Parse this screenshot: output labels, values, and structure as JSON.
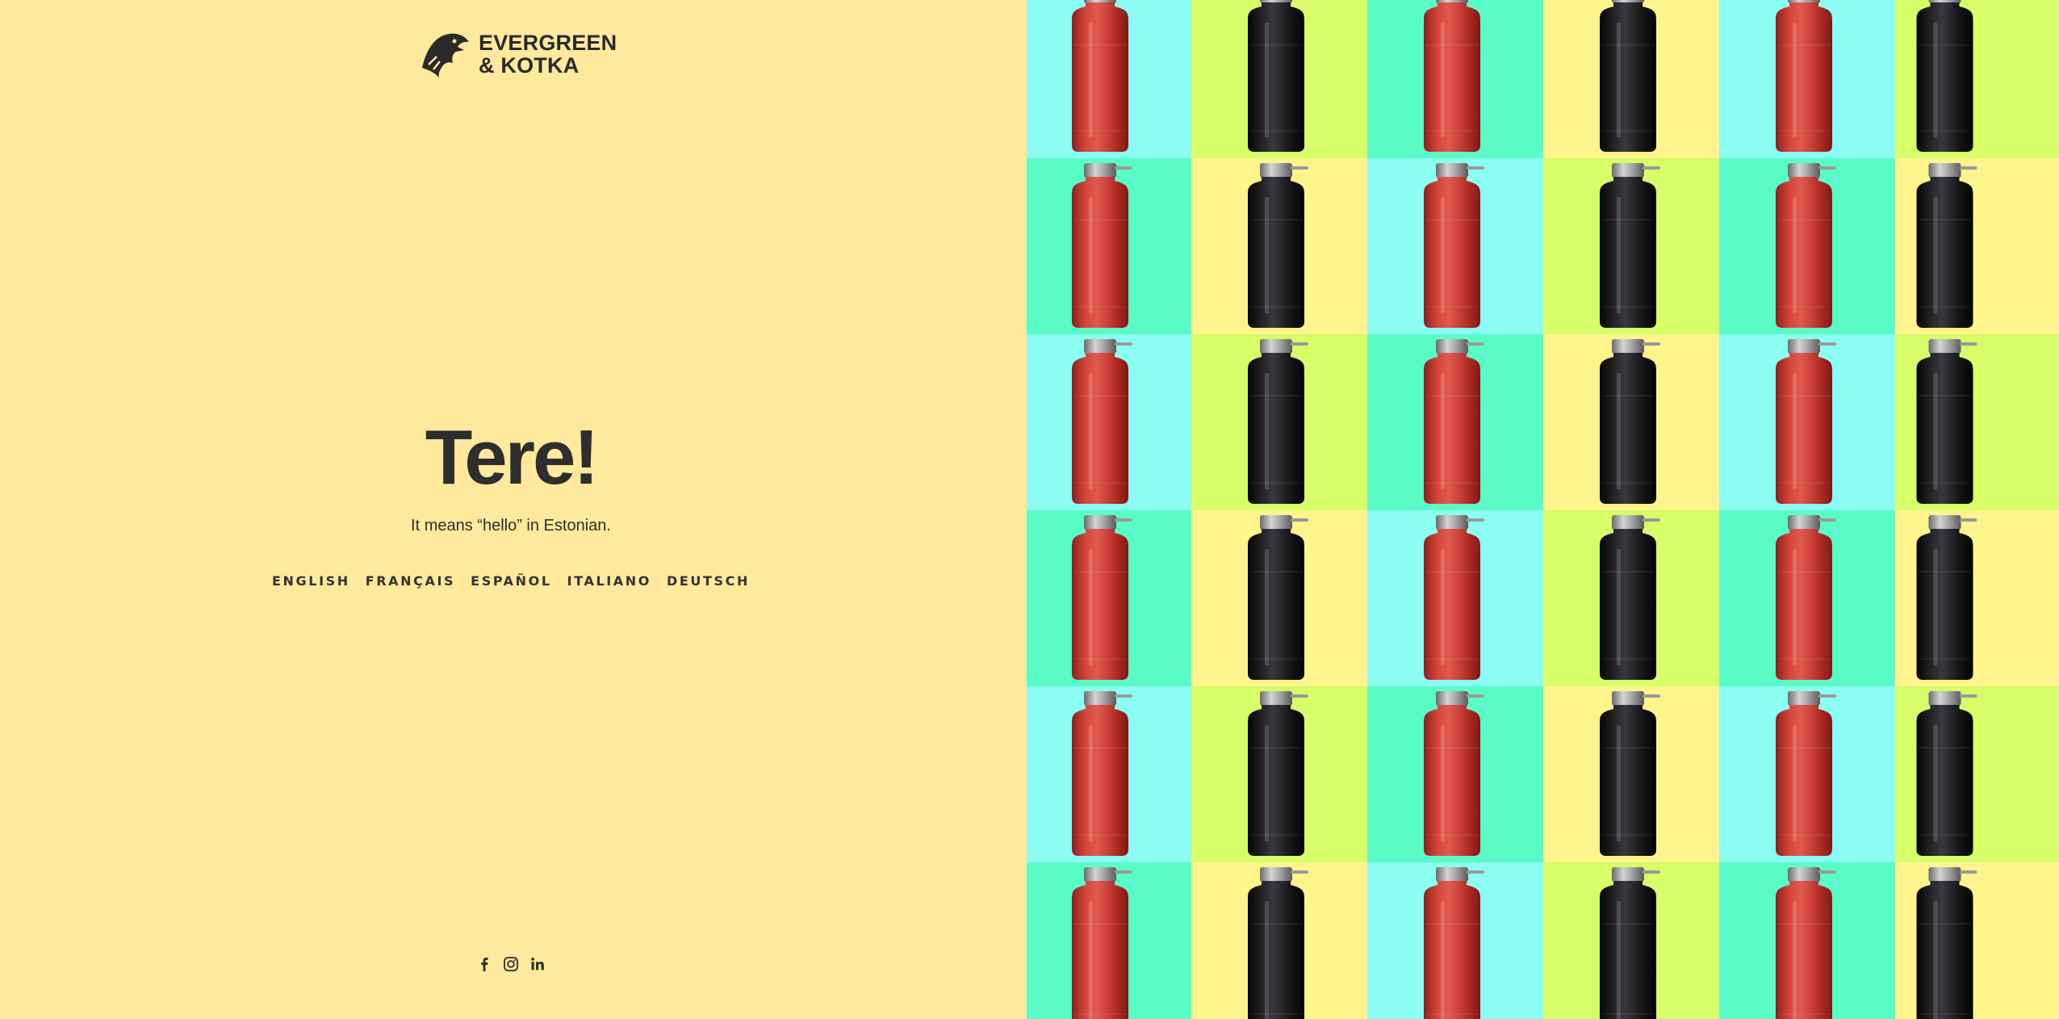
{
  "brand": {
    "line1": "EVERGREEN",
    "line2": "& KOTKA"
  },
  "hero": {
    "headline": "Tere!",
    "subline": "It means “hello” in Estonian."
  },
  "languages": [
    "ENGLISH",
    "FRANÇAIS",
    "ESPAÑOL",
    "ITALIANO",
    "DEUTSCH"
  ],
  "social": [
    "facebook-icon",
    "instagram-icon",
    "linkedin-icon"
  ],
  "colors": {
    "left_bg": "#ffe99d",
    "text": "#2e2e2e",
    "tile_cyan": "#8bfdf3",
    "tile_lime": "#d7fd68",
    "tile_mint": "#59fbc7",
    "tile_yellow": "#fdf48b",
    "bottle_red": "#c9362f",
    "bottle_black": "#1c1c1e"
  },
  "product_grid": {
    "columns": 6,
    "rows": 6,
    "bottle_pattern": [
      "red",
      "black",
      "red",
      "black",
      "red",
      "black"
    ],
    "tile_colors_odd_rows": [
      "cyan",
      "lime",
      "mint",
      "yellow",
      "cyan",
      "lime"
    ],
    "tile_colors_even_rows": [
      "mint",
      "yellow",
      "cyan",
      "lime",
      "mint",
      "yellow"
    ]
  }
}
